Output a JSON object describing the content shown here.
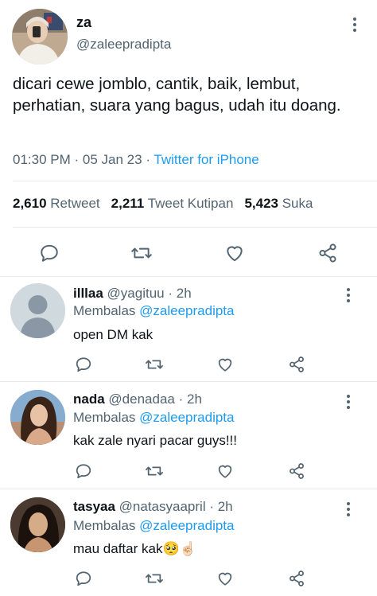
{
  "main_tweet": {
    "author_name": "za",
    "author_handle": "@zaleepradipta",
    "text": "dicari cewe jomblo, cantik, baik, lembut, perhatian, suara yang bagus, udah itu doang.",
    "time": "01:30 PM",
    "date": "05 Jan 23",
    "separator": "·",
    "client": "Twitter for iPhone",
    "stats": [
      {
        "value": "2,610",
        "label": "Retweet"
      },
      {
        "value": "2,211",
        "label": "Tweet Kutipan"
      },
      {
        "value": "5,423",
        "label": "Suka"
      }
    ]
  },
  "reply_prefix": "Membalas",
  "replies": [
    {
      "name": "illlaa",
      "handle": "@yagituu",
      "age": "· 2h",
      "reply_to": "@zaleepradipta",
      "text": "open DM kak"
    },
    {
      "name": "nada",
      "handle": "@denadaa",
      "age": "· 2h",
      "reply_to": "@zaleepradipta",
      "text": "kak zale nyari pacar guys!!!"
    },
    {
      "name": "tasyaa",
      "handle": "@natasyaapril",
      "age": "· 2h",
      "reply_to": "@zaleepradipta",
      "text": "mau daftar kak🥺☝🏻"
    }
  ],
  "icons": {
    "reply": "speech-bubble-icon",
    "retweet": "retweet-icon",
    "like": "heart-icon",
    "share": "share-icon",
    "more": "more-vertical-icon"
  },
  "colors": {
    "accent": "#1d9bf0",
    "secondary_text": "#536471",
    "divider": "#e7eaed"
  }
}
